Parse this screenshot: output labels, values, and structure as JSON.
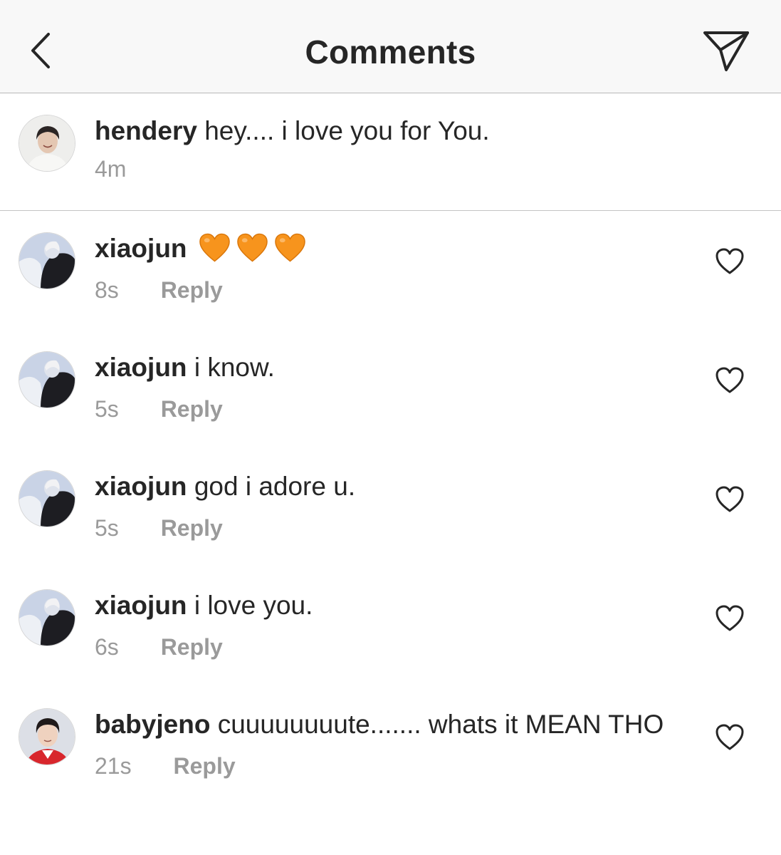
{
  "header": {
    "title": "Comments",
    "back_icon": "chevron-left-icon",
    "share_icon": "paper-plane-icon"
  },
  "caption": {
    "username": "hendery",
    "text": "hey.... i love you for You.",
    "time": "4m"
  },
  "comments": [
    {
      "username": "xiaojun",
      "text": "",
      "emoji": [
        "orange-heart",
        "orange-heart",
        "orange-heart"
      ],
      "time": "8s",
      "reply": "Reply"
    },
    {
      "username": "xiaojun",
      "text": "i know.",
      "time": "5s",
      "reply": "Reply"
    },
    {
      "username": "xiaojun",
      "text": "god i adore u.",
      "time": "5s",
      "reply": "Reply"
    },
    {
      "username": "xiaojun",
      "text": "i love you.",
      "time": "6s",
      "reply": "Reply"
    },
    {
      "username": "babyjeno",
      "text": "cuuuuuuuute....... whats it MEAN THO",
      "time": "21s",
      "reply": "Reply"
    }
  ],
  "colors": {
    "header_bg": "#f8f8f8",
    "text": "#262626",
    "muted": "#9a9a9a",
    "heart_emoji": "#f7941d"
  }
}
